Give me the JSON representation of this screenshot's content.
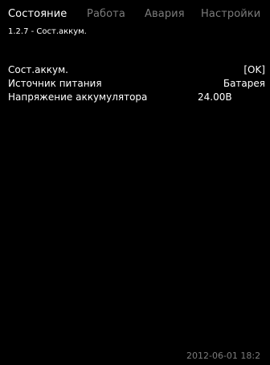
{
  "tabs": [
    {
      "label": "Состояние",
      "active": true
    },
    {
      "label": "Работа",
      "active": false
    },
    {
      "label": "Авария",
      "active": false
    },
    {
      "label": "Настройки",
      "active": false
    }
  ],
  "breadcrumb": "1.2.7 - Сост.аккум.",
  "params": [
    {
      "label": "Сост.аккум.",
      "value": "[OK]"
    },
    {
      "label": "Источник питания",
      "value": "Батарея"
    },
    {
      "label": "Напряжение аккумулятора",
      "value": "24.00В"
    }
  ],
  "status_bar": {
    "datetime": "2012-06-01 18:2"
  },
  "colors": {
    "background": "#000000",
    "text": "#ffffff",
    "inactive_text": "#7c7c7c"
  }
}
